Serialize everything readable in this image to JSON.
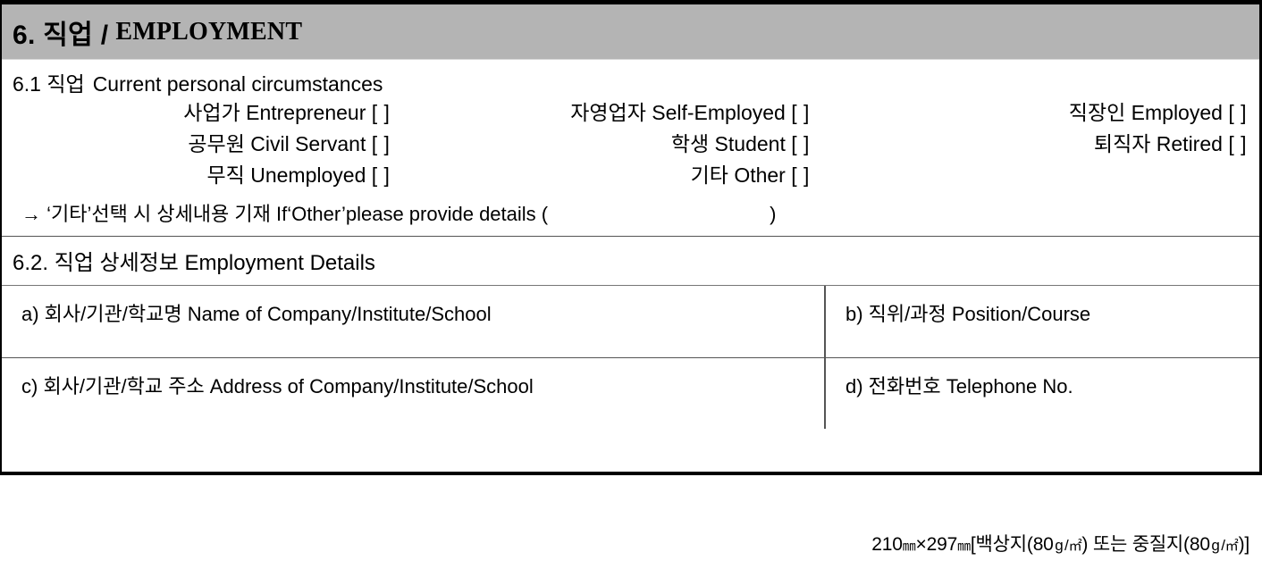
{
  "section": {
    "number_ko": "6. 직업 /",
    "title_en": "EMPLOYMENT"
  },
  "sub_61": {
    "label_ko": "6.1 직업",
    "label_en": "Current personal circumstances",
    "options": [
      {
        "ko": "사업가",
        "en": "Entrepreneur",
        "box": "[    ]"
      },
      {
        "ko": "자영업자",
        "en": "Self-Employed",
        "box": "[    ]"
      },
      {
        "ko": "직장인",
        "en": "Employed",
        "box": "[    ]"
      },
      {
        "ko": "공무원",
        "en": "Civil Servant",
        "box": "[    ]"
      },
      {
        "ko": "학생",
        "en": "Student",
        "box": "[    ]"
      },
      {
        "ko": "퇴직자",
        "en": "Retired",
        "box": "[    ]"
      },
      {
        "ko": "무직",
        "en": "Unemployed",
        "box": "[    ]"
      },
      {
        "ko": "기타",
        "en": "Other",
        "box": "[    ]"
      }
    ],
    "other_note": {
      "arrow": "→",
      "text_ko": "‘기타’선택 시 상세내용 기재",
      "text_en": "If‘Other’please provide details",
      "paren_open": "(",
      "paren_close": ")"
    }
  },
  "sub_62": {
    "heading": "6.2. 직업 상세정보 Employment Details",
    "cells": {
      "a": "a) 회사/기관/학교명 Name of Company/Institute/School",
      "b": "b) 직위/과정 Position/Course",
      "c": "c) 회사/기관/학교 주소 Address of Company/Institute/School",
      "d": "d) 전화번호 Telephone No."
    }
  },
  "footer": {
    "size": "210",
    "mm1": "㎜",
    "times": "×",
    "size2": "297",
    "mm2": "㎜",
    "bracket_open": "[백상지(",
    "weight1": "80",
    "g1": "g",
    "slash1": "/",
    "area1": "㎡",
    "mid": ") 또는 중질지(",
    "weight2": "80",
    "g2": "g",
    "slash2": "/",
    "area2": "㎡",
    "bracket_close": ")]"
  },
  "colors": {
    "header_bg": "#b4b4b4",
    "border": "#000000",
    "inner_rule": "#555555"
  }
}
